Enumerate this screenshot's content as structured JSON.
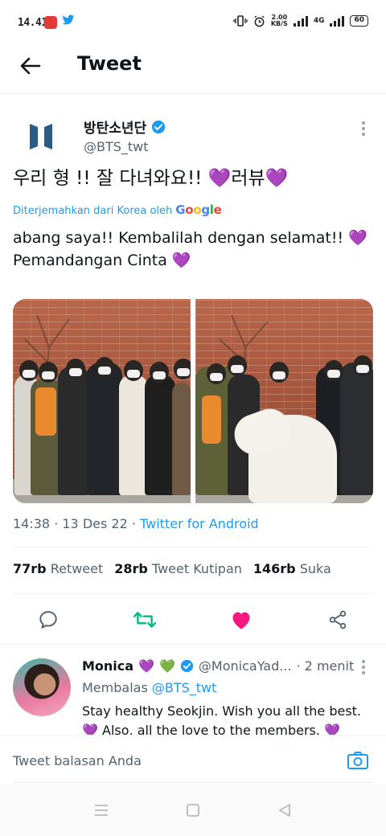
{
  "status_bar": {
    "time": "14.41",
    "net_speed_top": "2.00",
    "net_speed_bottom": "KB/S",
    "network": "4G",
    "battery": "60"
  },
  "header": {
    "title": "Tweet"
  },
  "tweet": {
    "author_name": "방탄소년단",
    "author_handle": "@BTS_twt",
    "text_prefix": "우리 형 !! 잘 다녀와요!! ",
    "text_mid": "러뷰",
    "heart": "💜",
    "translated_label": "Diterjemahkan dari Korea oleh",
    "google": [
      "G",
      "o",
      "o",
      "g",
      "l",
      "e"
    ],
    "translation_line1": "abang saya!! Kembalilah dengan selamat!! ",
    "translation_line2": "Pemandangan Cinta ",
    "meta_time": "14:38 · 13 Des 22 · ",
    "meta_source": "Twitter for Android",
    "stats": {
      "retweets": "77rb",
      "retweets_label": "Retweet",
      "quotes": "28rb",
      "quotes_label": "Tweet Kutipan",
      "likes": "146rb",
      "likes_label": "Suka"
    }
  },
  "reply": {
    "name": "Monica",
    "handle": "@MonicaYad...",
    "time": "· 2 menit",
    "replying_prefix": "Membalas ",
    "replying_mention": "@BTS_twt",
    "text_line1": "Stay healthy Seokjin. Wish you all the best.",
    "text_line2": " Also, all the love to the members. "
  },
  "composer": {
    "placeholder": "Tweet balasan Anda"
  },
  "colors": {
    "accent": "#1d9bf0",
    "like": "#f91880",
    "retweet": "#00ba7c",
    "purple_heart": "#a98bd9"
  }
}
